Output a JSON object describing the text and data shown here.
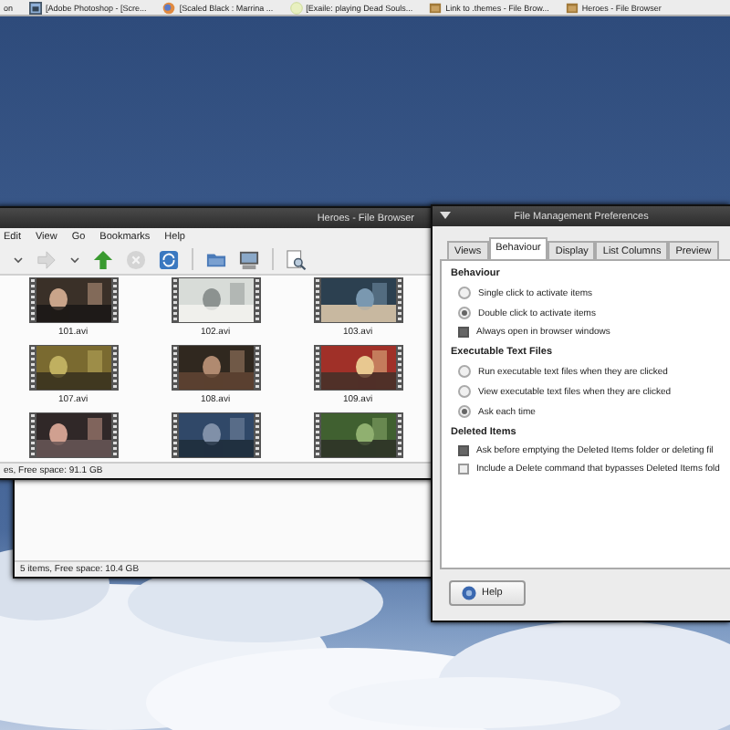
{
  "taskbar": {
    "items": [
      {
        "label": "on",
        "kind": "plain"
      },
      {
        "label": "[Adobe Photoshop - [Scre...",
        "kind": "image-app"
      },
      {
        "label": "[Scaled Black : Marrina ...",
        "kind": "browser"
      },
      {
        "label": "[Exaile: playing Dead Souls...",
        "kind": "player"
      },
      {
        "label": "Link to .themes - File Brow...",
        "kind": "folder"
      },
      {
        "label": "Heroes - File Browser",
        "kind": "folder"
      }
    ]
  },
  "back_window": {
    "status_bar": "5 items, Free space: 10.4 GB"
  },
  "file_browser": {
    "title": "Heroes - File Browser",
    "menu": [
      "Edit",
      "View",
      "Go",
      "Bookmarks",
      "Help"
    ],
    "files": [
      {
        "kind": "picture",
        "label": "101.avi"
      },
      {
        "kind": "picture",
        "label": "102.avi"
      },
      {
        "kind": "picture",
        "label": "103.avi"
      },
      {
        "kind": "picture",
        "label": "107.avi"
      },
      {
        "kind": "picture",
        "label": "108.avi"
      },
      {
        "kind": "picture",
        "label": "109.avi"
      },
      {
        "kind": "picture"
      },
      {
        "kind": "picture"
      },
      {
        "kind": "picture"
      }
    ],
    "status_bar": "es, Free space: 91.1 GB"
  },
  "preferences": {
    "title": "File Management Preferences",
    "tabs": [
      {
        "label": "Views",
        "selected": false
      },
      {
        "label": "Behaviour",
        "selected": true
      },
      {
        "label": "Display",
        "selected": false
      },
      {
        "label": "List Columns",
        "selected": false
      },
      {
        "label": "Preview",
        "selected": false
      }
    ],
    "sections": [
      {
        "heading": "Behaviour",
        "options": [
          {
            "kind": "radio",
            "label": "Single click to activate items",
            "selected": false
          },
          {
            "kind": "radio",
            "label": "Double click to activate items",
            "selected": true
          },
          {
            "kind": "checkbox",
            "label": "Always open in browser windows",
            "checked": true
          }
        ]
      },
      {
        "heading": "Executable Text Files",
        "options": [
          {
            "kind": "radio",
            "label": "Run executable text files when they are clicked",
            "selected": false
          },
          {
            "kind": "radio",
            "label": "View executable text files when they are clicked",
            "selected": false
          },
          {
            "kind": "radio",
            "label": "Ask each time",
            "selected": true
          }
        ]
      },
      {
        "heading": "Deleted Items",
        "options": [
          {
            "kind": "checkbox",
            "label": "Ask before emptying the Deleted Items folder or deleting fil",
            "checked": true
          },
          {
            "kind": "checkbox",
            "label": "Include a Delete command that bypasses Deleted Items fold",
            "checked": false
          }
        ]
      }
    ],
    "help_button": "Help"
  }
}
